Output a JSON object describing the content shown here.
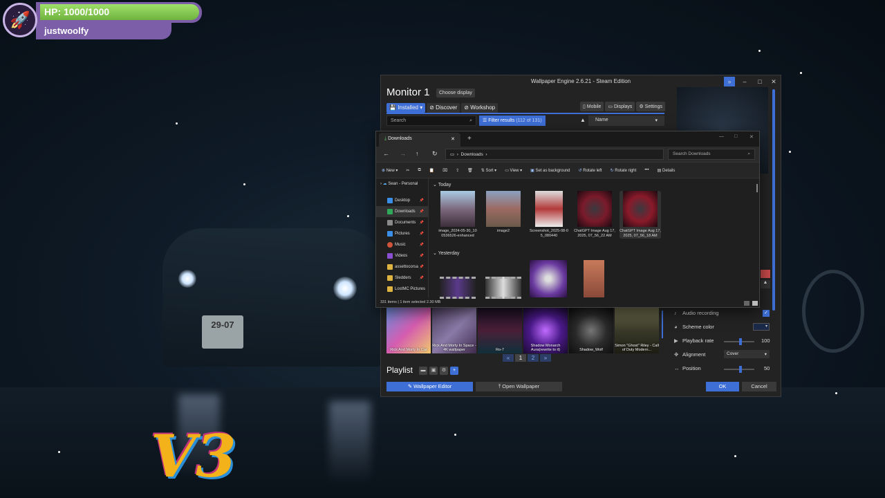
{
  "hud": {
    "hp": "HP: 1000/1000",
    "username": "justwoolfy",
    "hp_fraction": 1.0
  },
  "overlay_logo": "V3",
  "scene": {
    "plate": "29-07"
  },
  "wallpaper_engine": {
    "title": "Wallpaper Engine 2.6.21 - Steam Edition",
    "monitor": "Monitor 1",
    "choose_display": "Choose display",
    "tabs": [
      "Installed",
      "Discover",
      "Workshop"
    ],
    "right_buttons": [
      "Mobile",
      "Displays",
      "Settings"
    ],
    "search_placeholder": "Search",
    "filter_label": "Filter results",
    "filter_count": "(112 of 131)",
    "sort_value": "Name",
    "thumbnails": [
      {
        "label": "Rick And Morty In Car"
      },
      {
        "label": "Rick And Morty In Space - 4K wallpaper"
      },
      {
        "label": "Ro-7"
      },
      {
        "label": "Shadow Monarch Aura(rewrite to it)"
      },
      {
        "label": "Shadow_Wolf"
      },
      {
        "label": "Simon \"Ghost\" Riley - Call of Duty Modern..."
      }
    ],
    "pages": [
      "1",
      "2"
    ],
    "playlist_label": "Playlist",
    "wallpaper_editor": "Wallpaper Editor",
    "open_wallpaper": "Open Wallpaper",
    "properties": {
      "audio_recording": "Audio recording",
      "scheme_color": "Scheme color",
      "playback_rate": "Playback rate",
      "playback_value": "100",
      "alignment": "Alignment",
      "alignment_value": "Cover",
      "position": "Position",
      "position_value": "50"
    },
    "ok": "OK",
    "cancel": "Cancel"
  },
  "explorer": {
    "tab_title": "Downloads",
    "breadcrumb": "Downloads",
    "search_placeholder": "Search Downloads",
    "toolbar": {
      "new": "New",
      "sort": "Sort",
      "view": "View",
      "set_background": "Set as background",
      "rotate_left": "Rotate left",
      "rotate_right": "Rotate right",
      "details": "Details"
    },
    "sidebar_top": "Sean - Personal",
    "sidebar": [
      "Desktop",
      "Downloads",
      "Documents",
      "Pictures",
      "Music",
      "Videos",
      "assettocorsa",
      "Sledders",
      "LostMC Pictures"
    ],
    "group_today": "Today",
    "group_yesterday": "Yesterday",
    "files_today": [
      {
        "name": "image_2024-05-30_10 0536526-enhanced"
      },
      {
        "name": "image2"
      },
      {
        "name": "Screenshot_2025-08-0 5_080440"
      },
      {
        "name": "ChatGPT Image Aug 17, 2025, 07_56_22 AM"
      },
      {
        "name": "ChatGPT Image Aug 17, 2025, 07_56_18 AM"
      }
    ],
    "status": "331 items  |  1 item selected  2.30 MB"
  },
  "colors": {
    "accent": "#3e6fd6",
    "hp_green": "#7ec44b",
    "hud_purple": "#7b5ea7"
  }
}
